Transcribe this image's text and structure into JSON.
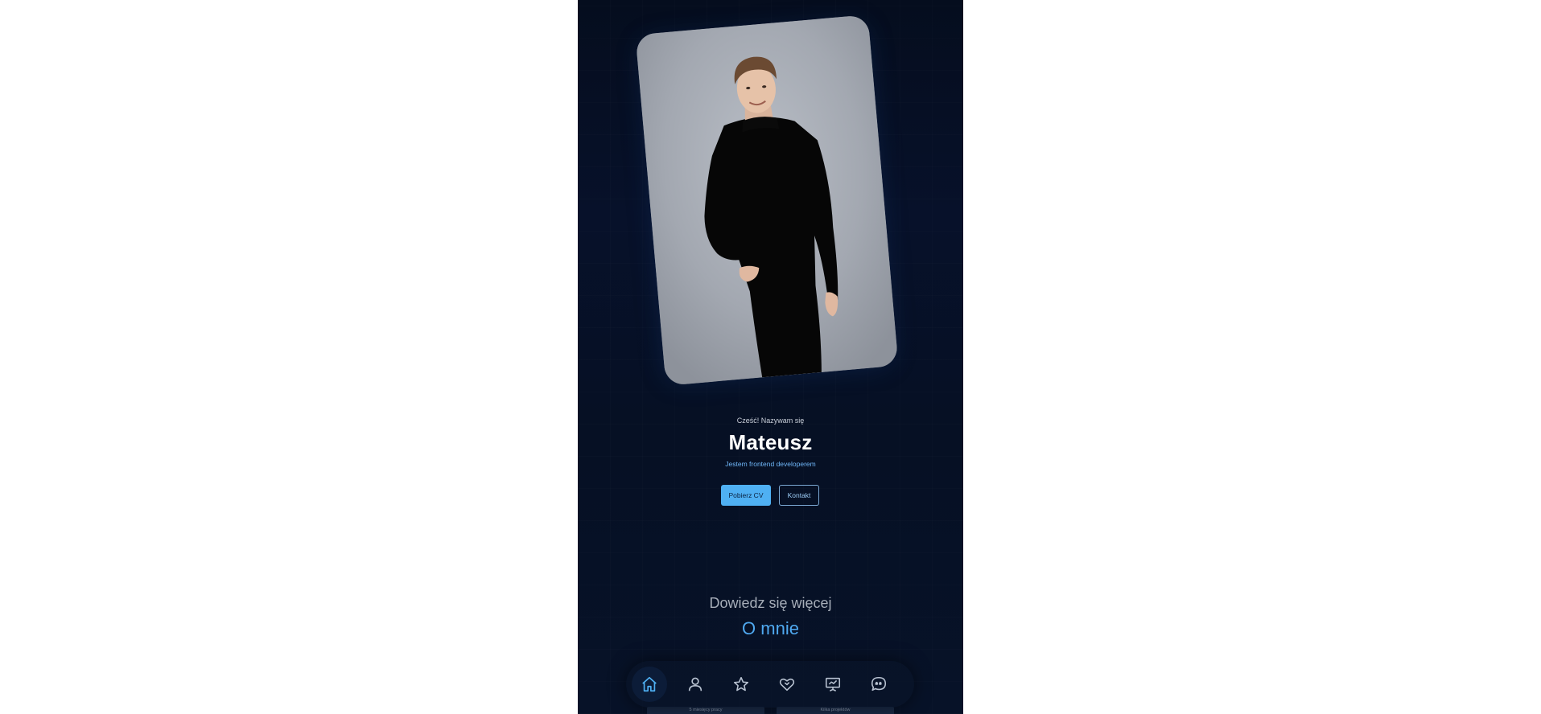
{
  "hero": {
    "greeting": "Cześć! Nazywam się",
    "name": "Mateusz",
    "tagline": "Jestem frontend developerem",
    "cv_button": "Pobierz CV",
    "contact_button": "Kontakt"
  },
  "section": {
    "subtitle": "Dowiedz się więcej",
    "title": "O mnie"
  },
  "bottom_nav": {
    "items": [
      {
        "icon": "home-icon",
        "active": true
      },
      {
        "icon": "user-icon",
        "active": false
      },
      {
        "icon": "star-icon",
        "active": false
      },
      {
        "icon": "heart-handshake-icon",
        "active": false
      },
      {
        "icon": "presentation-icon",
        "active": false
      },
      {
        "icon": "chat-quote-icon",
        "active": false
      }
    ]
  },
  "cards": {
    "card_1": "5 miesięcy pracy",
    "card_2": "Kilka projektów"
  },
  "colors": {
    "background": "#061024",
    "accent": "#4fb0f3",
    "accent_text": "#4fa9f0",
    "photo_frame": "#1b3d6b"
  }
}
